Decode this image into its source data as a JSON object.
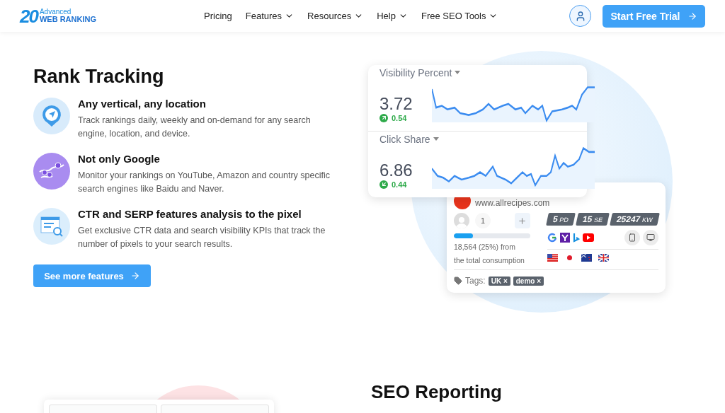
{
  "header": {
    "logo": {
      "number": "20",
      "line1": "Advanced",
      "line2": "WEB RANKING"
    },
    "nav": [
      {
        "label": "Pricing",
        "dropdown": false
      },
      {
        "label": "Features",
        "dropdown": true
      },
      {
        "label": "Resources",
        "dropdown": true
      },
      {
        "label": "Help",
        "dropdown": true
      },
      {
        "label": "Free SEO Tools",
        "dropdown": true
      }
    ],
    "cta": "Start Free Trial"
  },
  "section": {
    "title": "Rank Tracking",
    "features": [
      {
        "kind": "location",
        "title": "Any vertical, any location",
        "text": "Track rankings daily, weekly and on-demand for any search engine, location, and device."
      },
      {
        "kind": "map",
        "title": "Not only Google",
        "text": "Monitor your rankings on YouTube, Amazon and country specific search engines like Baidu and Naver."
      },
      {
        "kind": "serp",
        "title": "CTR and SERP features analysis to the pixel",
        "text": "Get exclusive CTR data and search visibility KPIs that track the number of pixels to your search results."
      }
    ],
    "button": "See more features"
  },
  "metrics_card": [
    {
      "label": "Visibility Percent",
      "value": "3.72",
      "change": "0.54",
      "kind": "rising"
    },
    {
      "label": "Click Share",
      "value": "6.86",
      "change": "0.44",
      "kind": "falling"
    }
  ],
  "project_card": {
    "url": "www.allrecipes.com",
    "users": "1",
    "level": 0.25,
    "usage": "18,564 (25%) from the total consumption",
    "stats": [
      {
        "value": "5",
        "unit": "PD"
      },
      {
        "value": "15",
        "unit": "SE"
      },
      {
        "value": "25247",
        "unit": "KW"
      }
    ],
    "tags_label": "Tags:",
    "tags": [
      {
        "label": "UK",
        "remove": "×"
      },
      {
        "label": "demo",
        "remove": "×"
      }
    ]
  },
  "next_section": {
    "title": "SEO Reporting"
  }
}
